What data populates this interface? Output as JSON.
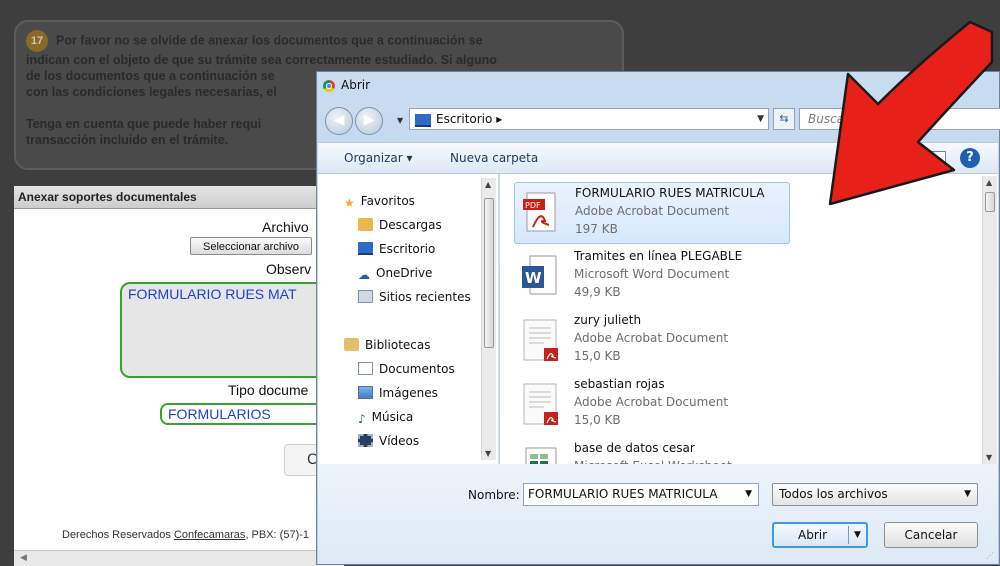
{
  "background": {
    "notice": {
      "number": "17",
      "paragraph1": "Por favor no se olvide de anexar los documentos que a continuación se indican con el objeto de que su trámite sea correctamente estudiado. Si alguno de los documentos que a continuación se ... con las condiciones legales necesarias, el ...",
      "line1": "Por favor no se olvide de anexar los documentos que a continuación se",
      "line2": "indican con el objeto de que su trámite sea correctamente estudiado. Si alguno",
      "line3": "de los documentos que a continuación se",
      "line4": "con las condiciones legales necesarias, el",
      "line5": "Tenga en cuenta que puede haber requi",
      "line6": "transacción incluido en el trámite."
    },
    "panel": {
      "title": "Anexar soportes documentales",
      "archivo_label": "Archivo",
      "select_button": "Seleccionar archivo",
      "observ_label": "Observ",
      "observ_value": "FORMULARIO RUES MAT",
      "tipo_label": "Tipo docume",
      "tipo_value": "FORMULARIOS",
      "button_fragment": "C",
      "footer_text": "Derechos Reservados ",
      "footer_link": "Confecamaras",
      "footer_rest": ", PBX: (57)-1"
    }
  },
  "dialog": {
    "title": "Abrir",
    "address": "Escritorio",
    "address_sep": "▸",
    "search_placeholder": "Buscar Escrit",
    "toolbar": {
      "organize": "Organizar ▾",
      "new_folder": "Nueva carpeta",
      "help": "?"
    },
    "nav": {
      "favorites": "Favoritos",
      "downloads": "Descargas",
      "desktop": "Escritorio",
      "onedrive": "OneDrive",
      "recent": "Sitios recientes",
      "libraries": "Bibliotecas",
      "documents": "Documentos",
      "images": "Imágenes",
      "music": "Música",
      "videos": "Vídeos"
    },
    "files": [
      {
        "name": "FORMULARIO RUES MATRICULA",
        "type": "Adobe Acrobat Document",
        "size": "197 KB",
        "icon": "pdf-icon"
      },
      {
        "name": "Tramites en línea PLEGABLE",
        "type": "Microsoft Word Document",
        "size": "49,9 KB",
        "icon": "word-icon"
      },
      {
        "name": "zury julieth",
        "type": "Adobe Acrobat Document",
        "size": "15,0 KB",
        "icon": "pdf-thumb-icon"
      },
      {
        "name": "sebastian rojas",
        "type": "Adobe Acrobat Document",
        "size": "15,0 KB",
        "icon": "pdf-thumb-icon"
      },
      {
        "name": "base de datos cesar",
        "type": "Microsoft Excel Worksheet",
        "size": "",
        "icon": "excel-icon"
      }
    ],
    "filename_label": "Nombre:",
    "filename_value": "FORMULARIO RUES MATRICULA",
    "filter_value": "Todos los archivos",
    "open_button": "Abrir",
    "cancel_button": "Cancelar"
  },
  "colors": {
    "annotation_arrow": "#e8201a",
    "accent": "#3c9bdf"
  }
}
